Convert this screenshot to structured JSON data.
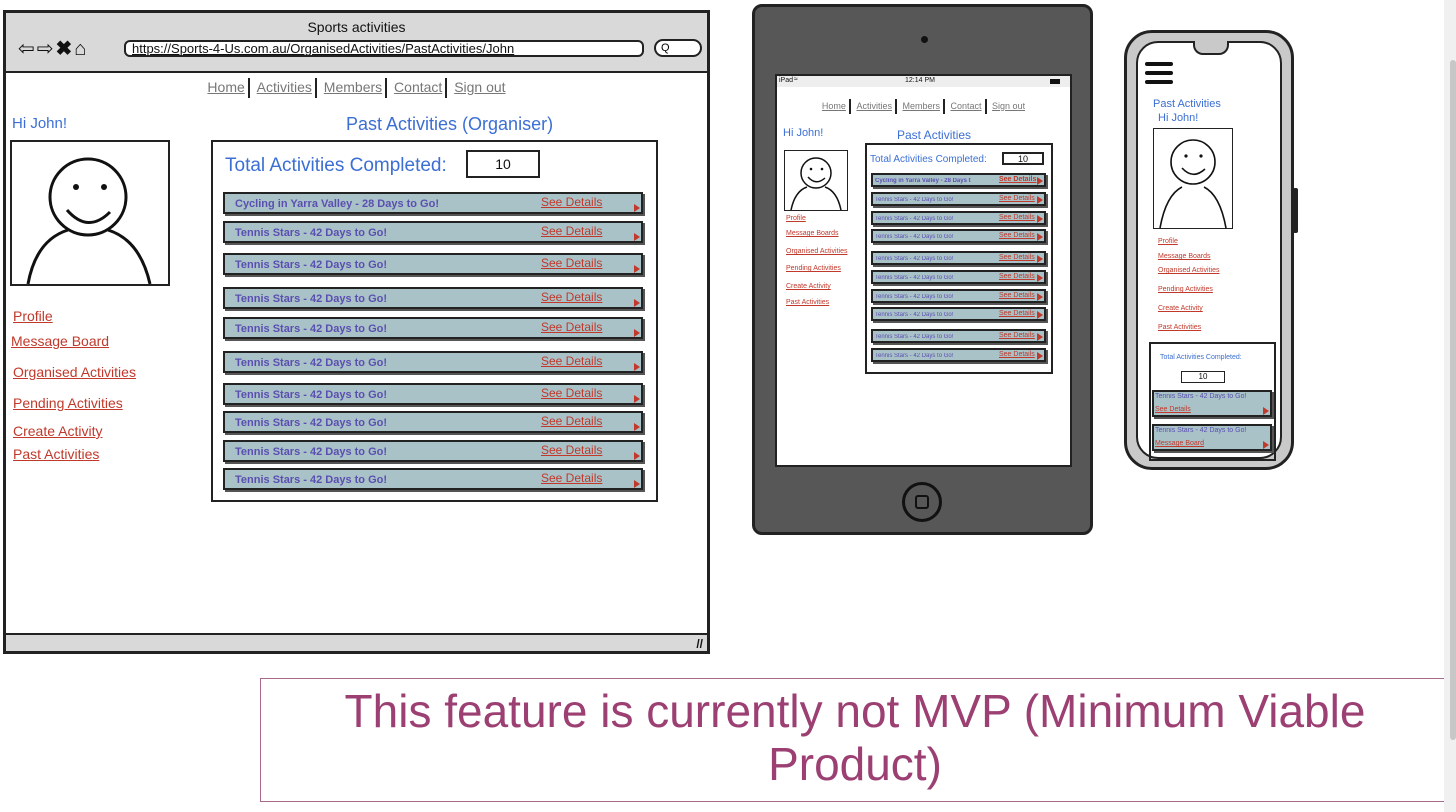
{
  "desktop": {
    "window_title": "Sports activities",
    "url": "https://Sports-4-Us.com.au/OrganisedActivities/PastActivities/John",
    "search_glyph": "Q",
    "nav": [
      "Home",
      "Activities",
      "Members",
      "Contact",
      "Sign out"
    ],
    "greeting": "Hi John!",
    "heading": "Past Activities (Organiser)",
    "total_label": "Total Activities Completed:",
    "total_value": "10",
    "sidebar": [
      "Profile",
      "Message Board",
      "Organised Activities",
      "Pending Activities",
      "Create Activity",
      "Past Activities"
    ],
    "details_label": "See Details",
    "activities": [
      "Cycling in Yarra Valley - 28 Days to Go!",
      "Tennis Stars - 42 Days to Go!",
      "Tennis Stars - 42 Days to Go!",
      "Tennis Stars - 42 Days to Go!",
      "Tennis Stars - 42 Days to Go!",
      "Tennis Stars - 42 Days to Go!",
      "Tennis Stars - 42 Days to Go!",
      "Tennis Stars - 42 Days to Go!",
      "Tennis Stars - 42 Days to Go!",
      "Tennis Stars - 42 Days to Go!"
    ]
  },
  "tablet": {
    "status_left": "iPad",
    "status_time": "12:14 PM",
    "nav": [
      "Home",
      "Activities",
      "Members",
      "Contact",
      "Sign out"
    ],
    "greeting": "Hi John!",
    "heading": "Past Activities",
    "total_label": "Total Activities Completed:",
    "total_value": "10",
    "sidebar": [
      "Profile",
      "Message Boards",
      "Organised Activities",
      "Pending Activities",
      "Create Activity",
      "Past Activities"
    ],
    "details_label": "See Details",
    "activities": [
      "Cycling in Yarra Valley - 28 Days t",
      "Tennis Stars - 42 Days to Go!",
      "Tennis Stars - 42 Days to Go!",
      "Tennis Stars - 42 Days to Go!",
      "Tennis Stars - 42 Days to Go!",
      "Tennis Stars - 42 Days to Go!",
      "Tennis Stars - 42 Days to Go!",
      "Tennis Stars - 42 Days to Go!",
      "Tennis Stars - 42 Days to Go!",
      "Tennis Stars - 42 Days to Go!"
    ]
  },
  "phone": {
    "title": "Past Activities",
    "greeting": "Hi John!",
    "sidebar": [
      "Profile",
      "Message Boards",
      "Organised Activities",
      "Pending Activities",
      "Create Activity",
      "Past Activities"
    ],
    "total_label": "Total Activities Completed:",
    "total_value": "10",
    "activities": [
      {
        "name": "Tennis Stars - 42 Days to Go!",
        "link": "See Details"
      },
      {
        "name": "Tennis Stars - 42 Days to Go!",
        "link": "Message Board"
      }
    ]
  },
  "note": "This feature is currently not MVP (Minimum Viable Product)",
  "colors": {
    "link": "#c0392b",
    "heading_blue": "#3b6fd4",
    "row_fill": "#a9c2c8",
    "row_text": "#5a4fb0",
    "note_text": "#9c3f72",
    "tablet_body": "#575757",
    "phone_body": "#c9c9c9"
  }
}
